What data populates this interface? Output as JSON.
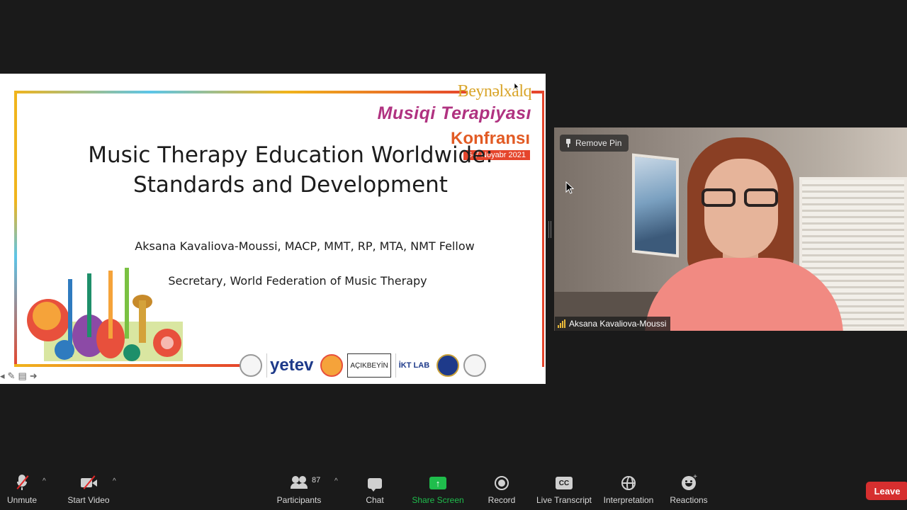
{
  "slide": {
    "conference": {
      "line1": "Beynəlxalq",
      "line2": "Musiqi Terapiyası",
      "line3": "Konfransı",
      "dates": "6-7 Noyabr 2021"
    },
    "title": "Music Therapy Education Worldwide: Standards and Development",
    "author": "Aksana Kavaliova-Moussi, MACP, MMT, RP, MTA, NMT Fellow",
    "organization": "Secretary, World Federation of Music Therapy",
    "logos": [
      "yetev",
      "AÇIKBEYİN",
      "İKT LAB"
    ]
  },
  "video": {
    "pin_label": "Remove Pin",
    "participant_name": "Aksana Kavaliova-Moussi"
  },
  "toolbar": {
    "unmute": "Unmute",
    "start_video": "Start Video",
    "participants": "Participants",
    "participants_count": "87",
    "chat": "Chat",
    "share_screen": "Share Screen",
    "record": "Record",
    "live_transcript": "Live Transcript",
    "cc": "CC",
    "interpretation": "Interpretation",
    "reactions": "Reactions",
    "leave": "Leave"
  },
  "colors": {
    "share_green": "#1fbd4c",
    "leave_red": "#d62f2f",
    "mute_slash": "#e02828"
  }
}
